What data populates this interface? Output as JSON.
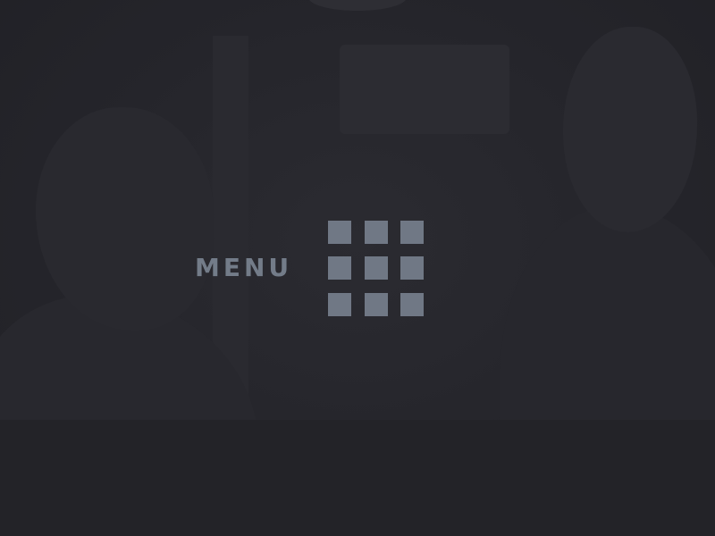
{
  "menu": {
    "label": "MENU",
    "icon": "grid-icon",
    "icon_color": "#707885",
    "label_color": "#737c89"
  },
  "background": {
    "color": "#24242a"
  }
}
